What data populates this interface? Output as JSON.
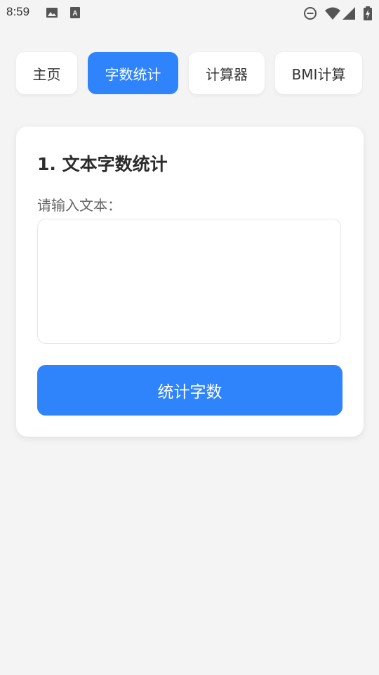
{
  "status_bar": {
    "time": "8:59",
    "icons": [
      "image-icon",
      "font-a-icon",
      "do-not-disturb-icon",
      "wifi-icon",
      "signal-icon",
      "battery-charging-icon"
    ]
  },
  "tabs": [
    {
      "label": "主页",
      "active": false
    },
    {
      "label": "字数统计",
      "active": true
    },
    {
      "label": "计算器",
      "active": false
    },
    {
      "label": "BMI计算",
      "active": false
    }
  ],
  "card": {
    "title": "1. 文本字数统计",
    "input_label": "请输入文本：",
    "textarea_value": "",
    "textarea_placeholder": "",
    "button_label": "统计字数"
  },
  "colors": {
    "accent": "#2f83fb",
    "background": "#f4f4f4",
    "card": "#ffffff"
  }
}
